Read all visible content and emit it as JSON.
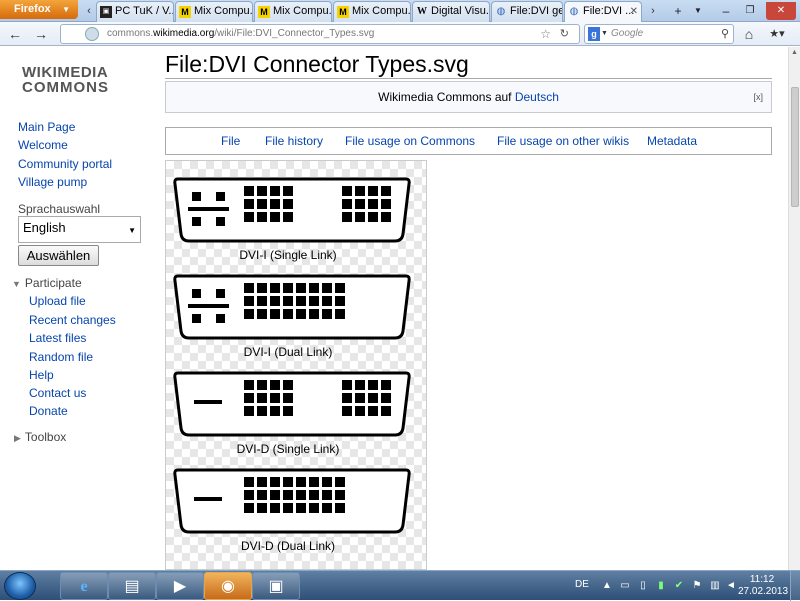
{
  "browser": {
    "menu_button": "Firefox",
    "tabs": [
      {
        "title": "PC TuK / V...",
        "icon": "pctuk-favicon"
      },
      {
        "title": "Mix Compu...",
        "icon": "mix-favicon"
      },
      {
        "title": "Mix Compu...",
        "icon": "mix-favicon"
      },
      {
        "title": "Mix Compu...",
        "icon": "mix-favicon"
      },
      {
        "title": "Digital Visu...",
        "icon": "wikipedia-favicon"
      },
      {
        "title": "File:DVI ger...",
        "icon": "commons-favicon"
      },
      {
        "title": "File:DVI ...",
        "icon": "commons-favicon",
        "active": true
      }
    ],
    "url_prefix": "commons.",
    "url_domain": "wikimedia.org",
    "url_path": "/wiki/File:DVI_Connector_Types.svg",
    "search_placeholder": "Google",
    "search_engine_letter": "g"
  },
  "sidebar": {
    "logo_line1": "WIKIMEDIA",
    "logo_line2": "COMMONS",
    "nav": [
      "Main Page",
      "Welcome",
      "Community portal",
      "Village pump"
    ],
    "language_label": "Sprachauswahl",
    "language_value": "English",
    "language_button": "Auswählen",
    "participate_label": "Participate",
    "participate_items": [
      "Upload file",
      "Recent changes",
      "Latest files",
      "Random file",
      "Help",
      "Contact us",
      "Donate"
    ],
    "toolbox_label": "Toolbox"
  },
  "content": {
    "title": "File:DVI Connector Types.svg",
    "lang_notice_text": "Wikimedia Commons auf",
    "lang_notice_link": "Deutsch",
    "lang_notice_close": "[x]",
    "file_nav": [
      "File",
      "File history",
      "File usage on Commons",
      "File usage on other wikis",
      "Metadata"
    ],
    "connectors": [
      "DVI-I (Single Link)",
      "DVI-I (Dual Link)",
      "DVI-D (Single Link)",
      "DVI-D (Dual Link)"
    ]
  },
  "taskbar": {
    "lang": "DE",
    "time": "11:12",
    "date": "27.02.2013"
  }
}
